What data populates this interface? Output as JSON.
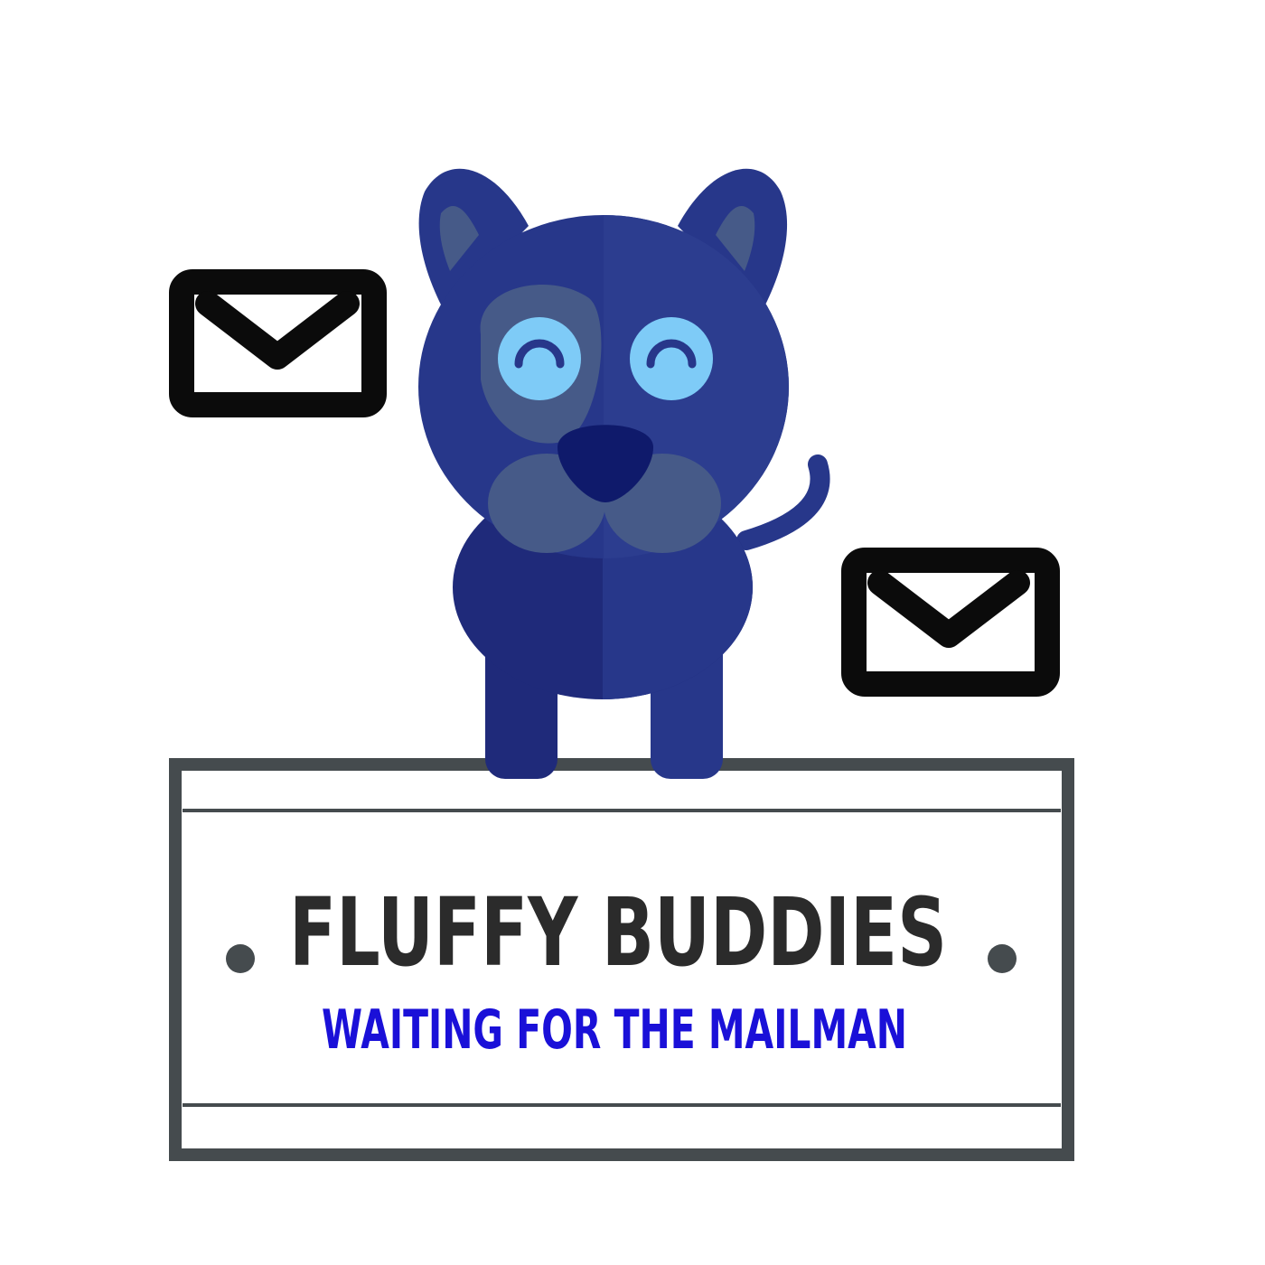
{
  "logo": {
    "title": "FLUFFY BUDDIES",
    "subtitle": "WAITING FOR THE MAILMAN"
  },
  "icons": {
    "left_envelope": "envelope-icon",
    "right_envelope": "envelope-icon",
    "mascot": "dog-mascot"
  },
  "colors": {
    "background": "#ffffff",
    "dog_body": "#27378a",
    "dog_body_dark": "#1f2a7a",
    "dog_patch": "#465a88",
    "dog_eye": "#7ecbf7",
    "dog_nose": "#0f1a6b",
    "envelope_stroke": "#0b0b0b",
    "sign_frame": "#454b4e",
    "title_color": "#2b2b2b",
    "subtitle_color": "#1a10d8"
  }
}
